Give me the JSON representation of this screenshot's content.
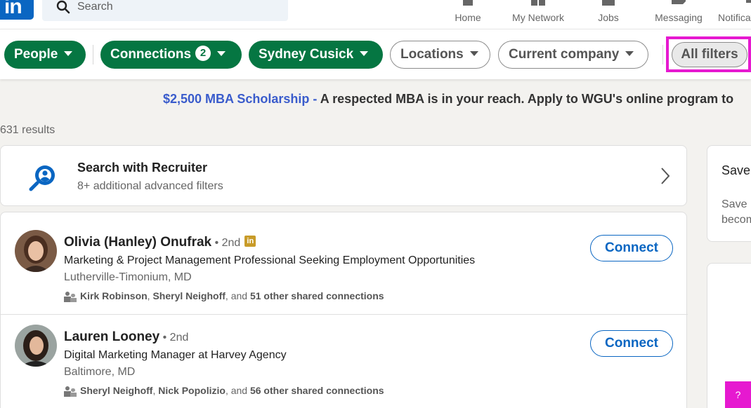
{
  "nav": {
    "logo_text": "in",
    "search_placeholder": "Search",
    "items": [
      {
        "label": "Home"
      },
      {
        "label": "My Network"
      },
      {
        "label": "Jobs"
      },
      {
        "label": "Messaging"
      },
      {
        "label": "Notifications"
      }
    ]
  },
  "filters": {
    "people": "People",
    "connections": "Connections",
    "connections_count": "2",
    "sydney": "Sydney Cusick",
    "locations": "Locations",
    "current_company": "Current company",
    "all_filters": "All filters"
  },
  "promo": {
    "link": "$2,500 MBA Scholarship -",
    "text": " A respected MBA is in your reach. Apply to WGU's online program to"
  },
  "results_count": "631 results",
  "recruiter": {
    "title": "Search with Recruiter",
    "subtitle": "8+ additional advanced filters"
  },
  "people": [
    {
      "name": "Olivia (Hanley) Onufrak",
      "degree": " • 2nd",
      "headline": "Marketing & Project Management Professional Seeking Employment Opportunities",
      "location": "Lutherville-Timonium, MD",
      "shared_a": "Kirk Robinson",
      "shared_sep1": ", ",
      "shared_b": "Sheryl Neighoff",
      "shared_sep2": ", and ",
      "shared_c": "51 other shared connections",
      "connect": "Connect"
    },
    {
      "name": "Lauren Looney",
      "degree": " • 2nd",
      "headline": "Digital Marketing Manager at Harvey Agency",
      "location": "Baltimore, MD",
      "shared_a": "Sheryl Neighoff",
      "shared_sep1": ", ",
      "shared_b": "Nick Popolizio",
      "shared_sep2": ", and ",
      "shared_c": "56 other shared connections",
      "connect": "Connect"
    }
  ],
  "side": {
    "title": "Save",
    "text_line1": "Save",
    "text_line2": "becom"
  },
  "help_label": "?",
  "colors": {
    "brand_blue": "#0a66c2",
    "filter_green": "#057642",
    "highlight_magenta": "#e619d0"
  }
}
